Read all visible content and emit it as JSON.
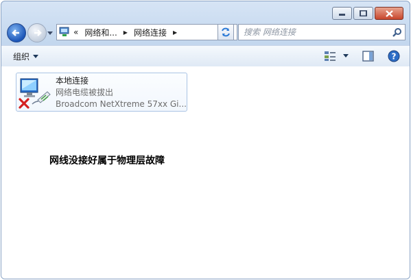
{
  "window": {
    "caption_buttons": [
      "minimize",
      "maximize",
      "close"
    ]
  },
  "address": {
    "overflow": "«",
    "crumbs": [
      "网络和...",
      "网络连接"
    ]
  },
  "search": {
    "placeholder": "搜索 网络连接"
  },
  "toolbar": {
    "organize_label": "组织"
  },
  "connection": {
    "name": "本地连接",
    "status": "网络电缆被拔出",
    "device": "Broadcom NetXtreme 57xx Gi..."
  },
  "annotation": {
    "text": "网线没接好属于物理层故障"
  },
  "colors": {
    "accent": "#1c56b8",
    "error": "#d42020",
    "frame": "#c3d7ee"
  }
}
